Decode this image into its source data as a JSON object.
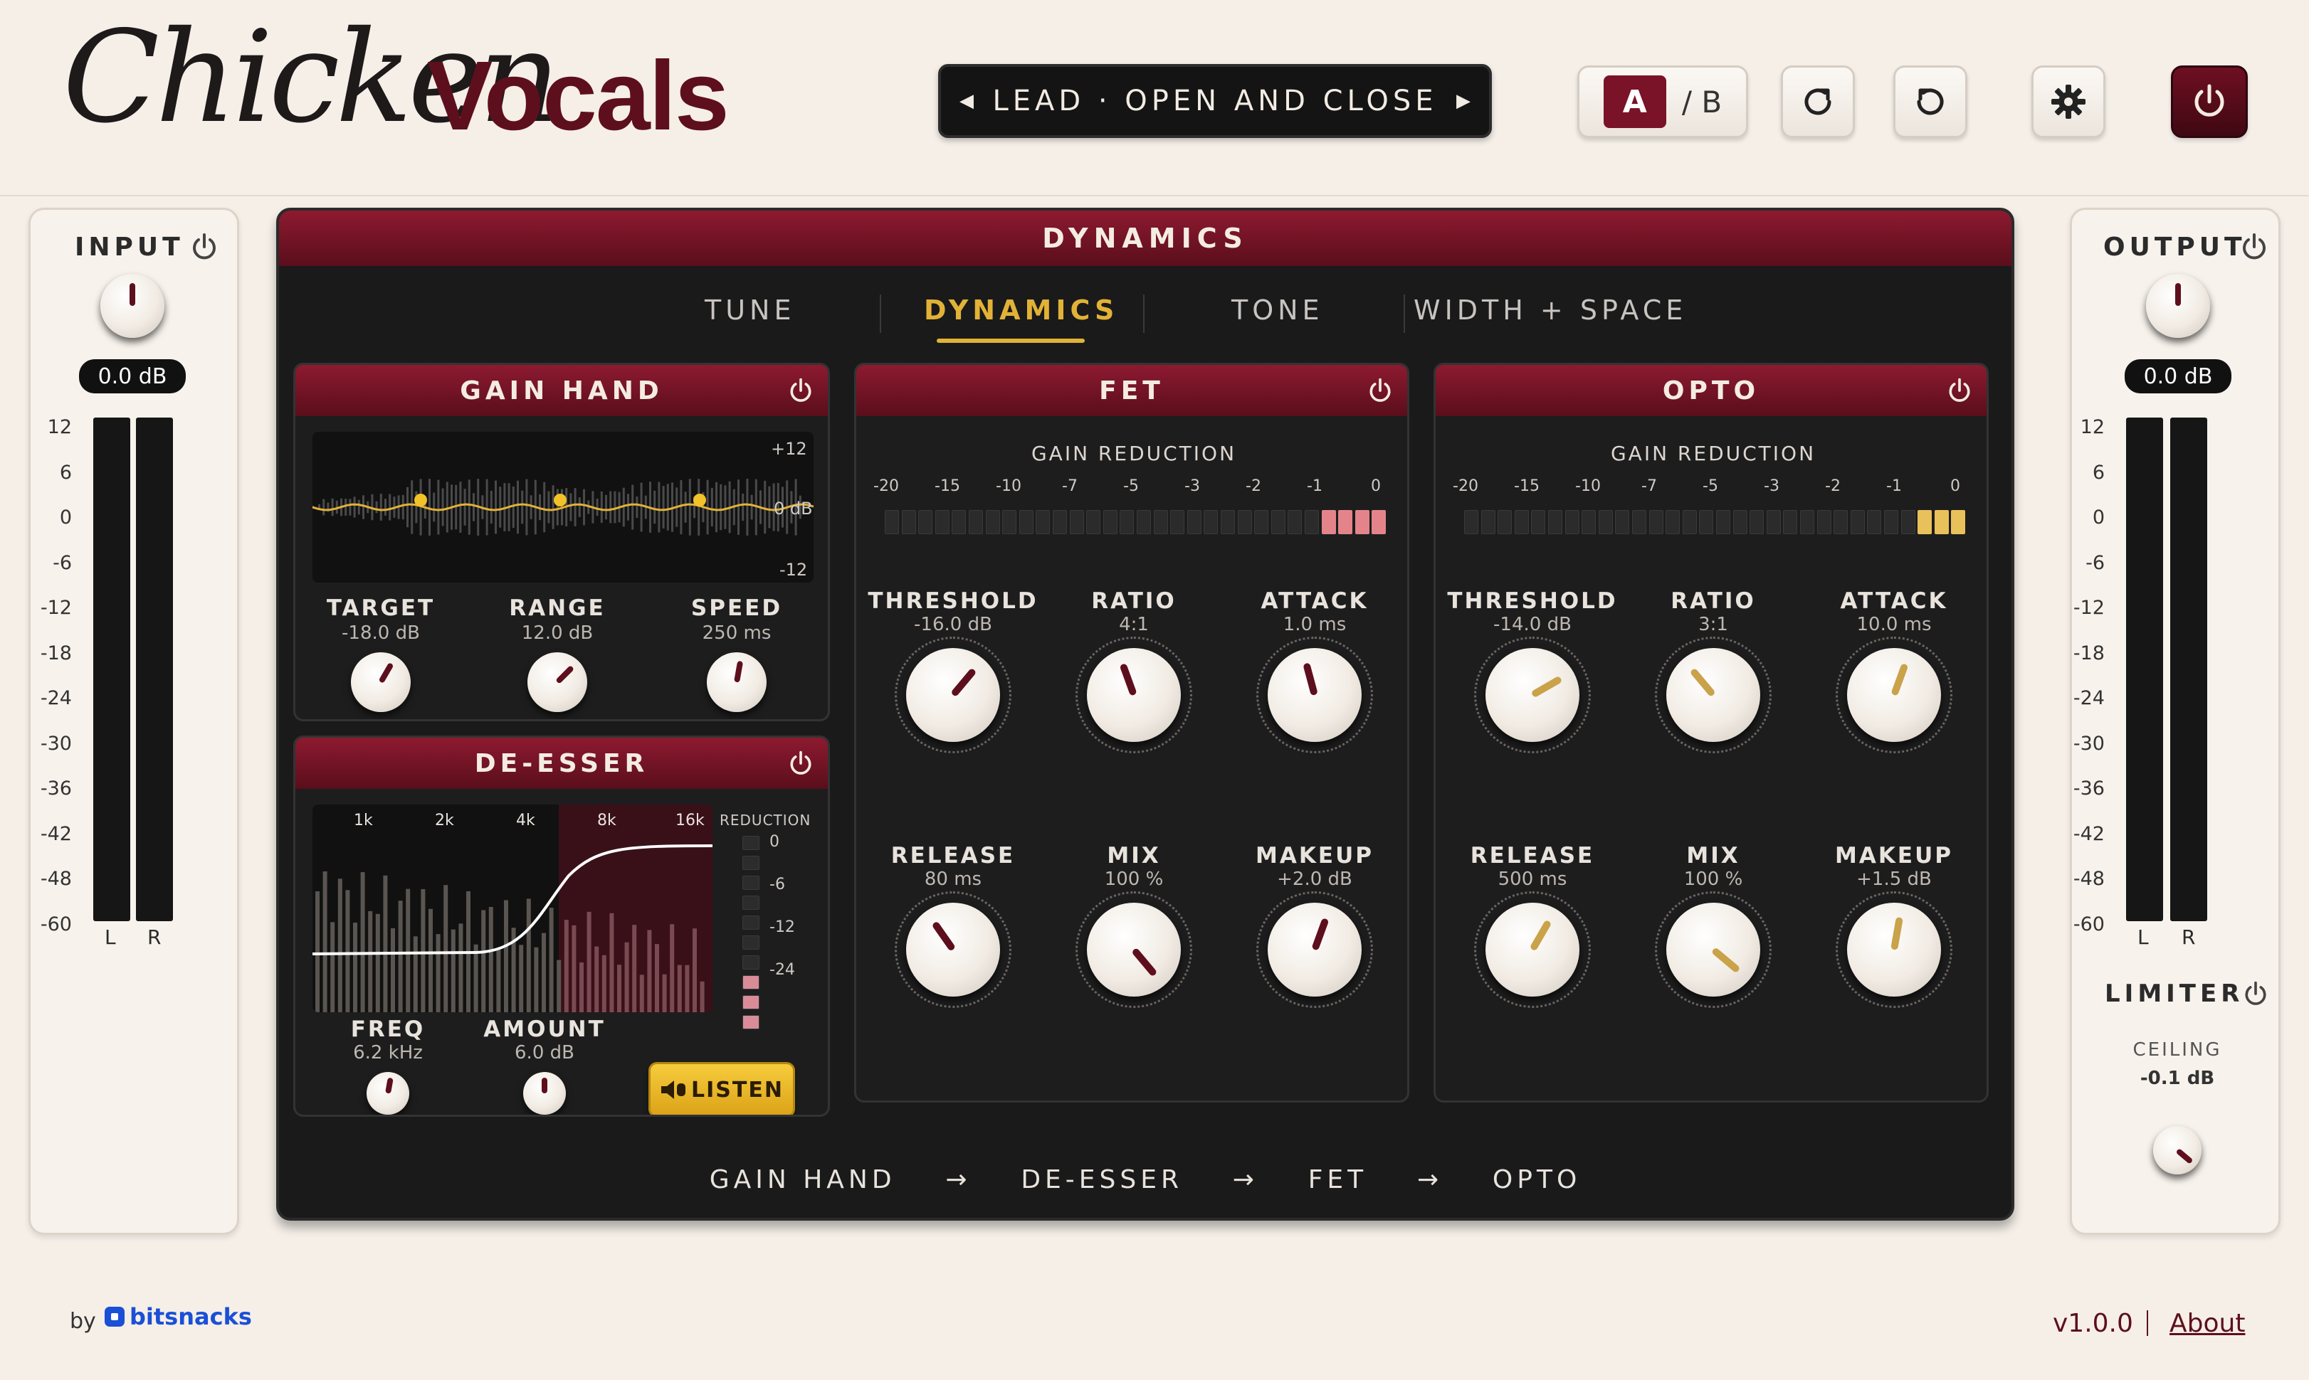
{
  "header": {
    "logo_script": "Chicken",
    "logo_bold": "Vocals",
    "preset_name": "LEAD · OPEN AND CLOSE",
    "ab_a": "A",
    "ab_b": "/ B"
  },
  "input": {
    "title": "INPUT",
    "value": "0.0 dB",
    "scale": [
      "12",
      "6",
      "0",
      "-6",
      "-12",
      "-18",
      "-24",
      "-30",
      "-36",
      "-42",
      "-48",
      "-60"
    ],
    "ch_l": "L",
    "ch_r": "R"
  },
  "output": {
    "title": "OUTPUT",
    "value": "0.0 dB",
    "scale": [
      "12",
      "6",
      "0",
      "-6",
      "-12",
      "-18",
      "-24",
      "-30",
      "-36",
      "-42",
      "-48",
      "-60"
    ],
    "ch_l": "L",
    "ch_r": "R",
    "limiter": "LIMITER",
    "ceiling_label": "CEILING",
    "ceiling_value": "-0.1 dB"
  },
  "main": {
    "title": "DYNAMICS",
    "tabs": [
      "TUNE",
      "DYNAMICS",
      "TONE",
      "WIDTH + SPACE"
    ],
    "active_tab": "DYNAMICS",
    "chain": [
      "GAIN HAND",
      "→",
      "DE-ESSER",
      "→",
      "FET",
      "→",
      "OPTO"
    ]
  },
  "gain_hand": {
    "title": "GAIN HAND",
    "scale_top": "+12",
    "scale_mid": "0 dB",
    "scale_bottom": "-12",
    "target_label": "TARGET",
    "target_value": "-18.0 dB",
    "range_label": "RANGE",
    "range_value": "12.0 dB",
    "speed_label": "SPEED",
    "speed_value": "250 ms"
  },
  "de_esser": {
    "title": "DE-ESSER",
    "freqs": [
      "1k",
      "2k",
      "4k",
      "8k",
      "16k"
    ],
    "reduction_label": "REDUCTION",
    "reduction_scale": [
      "0",
      "-6",
      "-12",
      "-24"
    ],
    "freq_label": "FREQ",
    "freq_value": "6.2 kHz",
    "amount_label": "AMOUNT",
    "amount_value": "6.0 dB",
    "listen_label": "LISTEN"
  },
  "fet": {
    "title": "FET",
    "gr_label": "GAIN REDUCTION",
    "gr_scale": [
      "-20",
      "-15",
      "-10",
      "-7",
      "-5",
      "-3",
      "-2",
      "-1",
      "0"
    ],
    "threshold_label": "THRESHOLD",
    "threshold_value": "-16.0 dB",
    "ratio_label": "RATIO",
    "ratio_value": "4:1",
    "attack_label": "ATTACK",
    "attack_value": "1.0 ms",
    "release_label": "RELEASE",
    "release_value": "80 ms",
    "mix_label": "MIX",
    "mix_value": "100 %",
    "makeup_label": "MAKEUP",
    "makeup_value": "+2.0 dB"
  },
  "opto": {
    "title": "OPTO",
    "gr_label": "GAIN REDUCTION",
    "gr_scale": [
      "-20",
      "-15",
      "-10",
      "-7",
      "-5",
      "-3",
      "-2",
      "-1",
      "0"
    ],
    "threshold_label": "THRESHOLD",
    "threshold_value": "-14.0 dB",
    "ratio_label": "RATIO",
    "ratio_value": "3:1",
    "attack_label": "ATTACK",
    "attack_value": "10.0 ms",
    "release_label": "RELEASE",
    "release_value": "500 ms",
    "mix_label": "MIX",
    "mix_value": "100 %",
    "makeup_label": "MAKEUP",
    "makeup_value": "+1.5 dB"
  },
  "footer": {
    "by": "by",
    "brand": "bitsnacks",
    "version": "v1.0.0",
    "about": "About"
  },
  "colors": {
    "brand_red": "#7a1327",
    "accent_gold": "#e2b237",
    "meter_green": "#1e8c1f",
    "meter_yellow": "#f2b51c",
    "fet_gr": "#e4848a",
    "opto_gr": "#e9c15a"
  },
  "icons": [
    "power-icon",
    "undo-icon",
    "redo-icon",
    "gear-icon",
    "chevron-left-icon",
    "chevron-right-icon",
    "speaker-icon",
    "bitsnacks-logo-icon"
  ]
}
